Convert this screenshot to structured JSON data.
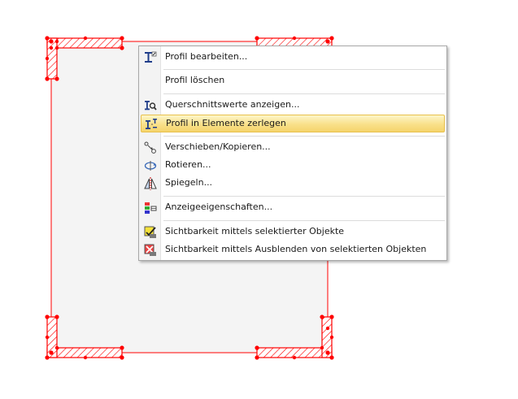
{
  "menu": {
    "items": [
      {
        "label": "Profil bearbeiten...",
        "icon": "profile-edit-icon"
      },
      {
        "label": "Profil löschen",
        "icon": ""
      },
      {
        "label": "Querschnittswerte anzeigen...",
        "icon": "section-values-icon"
      },
      {
        "label": "Profil in Elemente zerlegen",
        "icon": "decompose-profile-icon",
        "highlighted": true
      },
      {
        "label": "Verschieben/Kopieren...",
        "icon": "move-copy-icon"
      },
      {
        "label": "Rotieren...",
        "icon": "rotate-icon"
      },
      {
        "label": "Spiegeln...",
        "icon": "mirror-icon"
      },
      {
        "label": "Anzeigeeigenschaften...",
        "icon": "display-properties-icon"
      },
      {
        "label": "Sichtbarkeit mittels selektierter Objekte",
        "icon": "visibility-selected-icon"
      },
      {
        "label": "Sichtbarkeit mittels Ausblenden von selektierten Objekten",
        "icon": "visibility-hide-selected-icon"
      }
    ]
  },
  "colors": {
    "selection": "#ff0000",
    "profile_fill": "#f4f4f4",
    "highlight": "#f9e08a"
  }
}
